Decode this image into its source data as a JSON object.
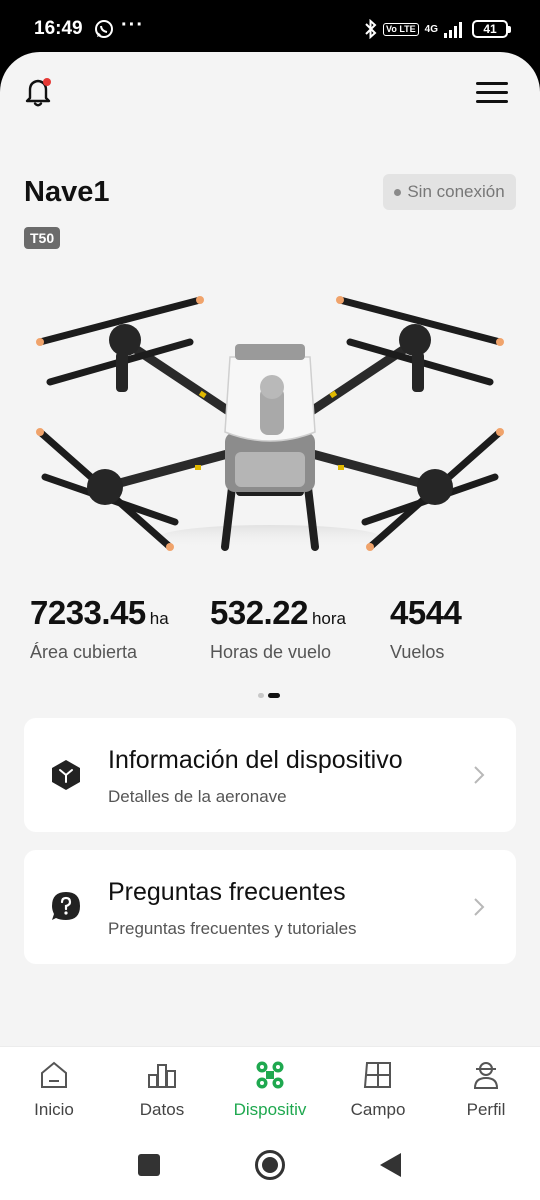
{
  "status_bar": {
    "time": "16:49",
    "dots": "···",
    "volte": "Vo LTE",
    "network": "4G",
    "battery": "41"
  },
  "header": {
    "notification_icon": "bell-icon",
    "menu_icon": "hamburger-icon"
  },
  "device": {
    "name": "Nave1",
    "model": "T50",
    "status": "Sin conexión",
    "image": "agricultural-drone-image"
  },
  "stats": [
    {
      "value": "7233.45",
      "unit": "ha",
      "label": "Área cubierta"
    },
    {
      "value": "532.22",
      "unit": "hora",
      "label": "Horas de vuelo"
    },
    {
      "value": "4544",
      "unit": "",
      "label": "Vuelos"
    }
  ],
  "pager": {
    "pages": 2,
    "active": 2
  },
  "cards": [
    {
      "title": "Información del dispositivo",
      "subtitle": "Detalles de la aeronave",
      "icon": "cube-icon"
    },
    {
      "title": "Preguntas frecuentes",
      "subtitle": "Preguntas frecuentes y tutoriales",
      "icon": "question-bubble-icon"
    }
  ],
  "bottom_nav": [
    {
      "label": "Inicio",
      "icon": "home-icon",
      "active": false
    },
    {
      "label": "Datos",
      "icon": "bar-chart-icon",
      "active": false
    },
    {
      "label": "Dispositiv",
      "icon": "drone-icon",
      "active": true
    },
    {
      "label": "Campo",
      "icon": "field-map-icon",
      "active": false
    },
    {
      "label": "Perfil",
      "icon": "profile-icon",
      "active": false
    }
  ],
  "colors": {
    "accent": "#1fa84f",
    "background": "#f4f4f4",
    "notification_dot": "#e53935"
  }
}
